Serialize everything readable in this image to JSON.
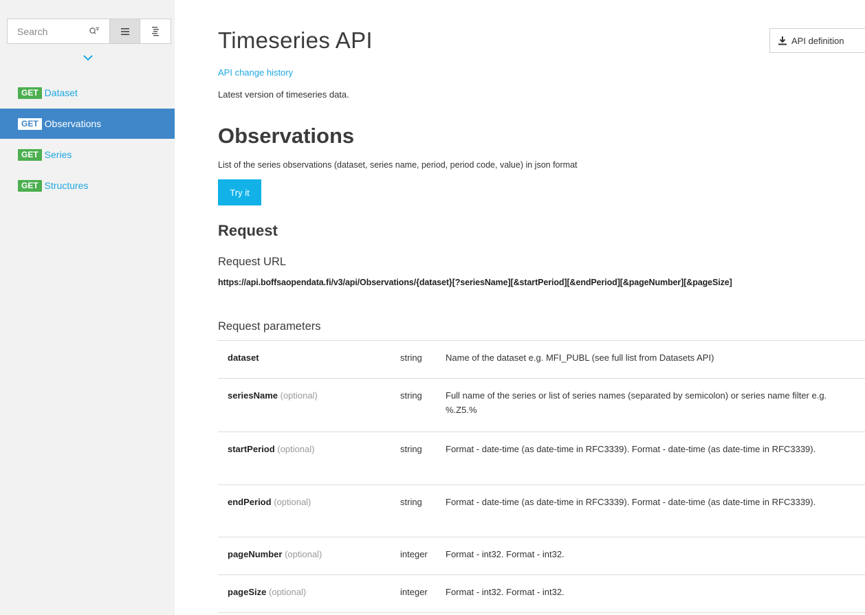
{
  "sidebar": {
    "search_placeholder": "Search",
    "nav_items": [
      {
        "method": "GET",
        "label": "Dataset",
        "active": false
      },
      {
        "method": "GET",
        "label": "Observations",
        "active": true
      },
      {
        "method": "GET",
        "label": "Series",
        "active": false
      },
      {
        "method": "GET",
        "label": "Structures",
        "active": false
      }
    ]
  },
  "header": {
    "api_definition_label": "API definition"
  },
  "main": {
    "title": "Timeseries API",
    "change_history_link": "API change history",
    "description": "Latest version of timeseries data.",
    "operation": {
      "title": "Observations",
      "description": "List of the series observations (dataset, series name, period, period code, value) in json format",
      "try_label": "Try it"
    },
    "request": {
      "heading": "Request",
      "url_heading": "Request URL",
      "url": "https://api.boffsaopendata.fi/v3/api/Observations/{dataset}[?seriesName][&startPeriod][&endPeriod][&pageNumber][&pageSize]",
      "params_heading": "Request parameters",
      "params": [
        {
          "name": "dataset",
          "optional": "",
          "type": "string",
          "desc": "Name of the dataset e.g. MFI_PUBL (see full list from Datasets API)"
        },
        {
          "name": "seriesName",
          "optional": " (optional)",
          "type": "string",
          "desc": "Full name of the series or list of series names (separated by semicolon) or series name filter e.g. %.Z5.%"
        },
        {
          "name": "startPeriod",
          "optional": " (optional)",
          "type": "string",
          "desc": "Format - date-time (as date-time in RFC3339). Format - date-time (as date-time in RFC3339)."
        },
        {
          "name": "endPeriod",
          "optional": " (optional)",
          "type": "string",
          "desc": "Format - date-time (as date-time in RFC3339). Format - date-time (as date-time in RFC3339)."
        },
        {
          "name": "pageNumber",
          "optional": " (optional)",
          "type": "integer",
          "desc": "Format - int32. Format - int32."
        },
        {
          "name": "pageSize",
          "optional": " (optional)",
          "type": "integer",
          "desc": "Format - int32. Format - int32."
        }
      ]
    }
  },
  "colors": {
    "accent": "#1ea8e0",
    "active_nav": "#3f87c8",
    "get_badge": "#4caf50",
    "try_button": "#12b2e8"
  }
}
